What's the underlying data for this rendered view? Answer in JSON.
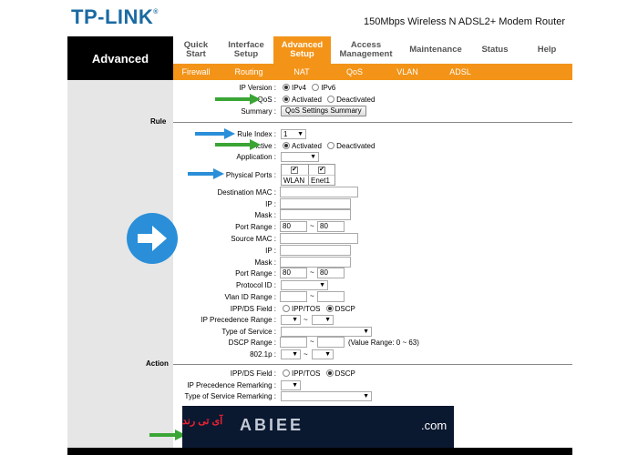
{
  "header": {
    "logo": "TP-LINK",
    "model": "150Mbps Wireless N ADSL2+ Modem Router"
  },
  "nav": {
    "left_title": "Advanced",
    "tabs": [
      {
        "l1": "Quick",
        "l2": "Start"
      },
      {
        "l1": "Interface",
        "l2": "Setup"
      },
      {
        "l1": "Advanced",
        "l2": "Setup"
      },
      {
        "l1": "Access",
        "l2": "Management"
      },
      {
        "l1": "Maintenance",
        "l2": ""
      },
      {
        "l1": "Status",
        "l2": ""
      },
      {
        "l1": "Help",
        "l2": ""
      }
    ],
    "subtabs": [
      "Firewall",
      "Routing",
      "NAT",
      "QoS",
      "VLAN",
      "ADSL"
    ]
  },
  "qos": {
    "ip_version_label": "IP Version :",
    "ipv4": "IPv4",
    "ipv6": "IPv6",
    "qos_label": "QoS :",
    "activated": "Activated",
    "deactivated": "Deactivated",
    "summary_label": "Summary :",
    "summary_button": "QoS Settings Summary"
  },
  "rule": {
    "section": "Rule",
    "rule_index_label": "Rule Index :",
    "rule_index_value": "1",
    "active_label": "Active :",
    "activated": "Activated",
    "deactivated": "Deactivated",
    "application_label": "Application :",
    "physical_ports_label": "Physical Ports :",
    "port_wlan": "WLAN",
    "port_enet1": "Enet1",
    "dest_mac_label": "Destination MAC :",
    "ip_label": "IP :",
    "mask_label": "Mask :",
    "port_range_label": "Port Range :",
    "port_from": "80",
    "port_to": "80",
    "tilde": "~",
    "source_mac_label": "Source MAC :",
    "protocol_id_label": "Protocol ID :",
    "vlan_range_label": "Vlan ID Range :",
    "ippds_label": "IPP/DS Field :",
    "ipptos": "IPP/TOS",
    "dscp": "DSCP",
    "ip_prec_range_label": "IP Precedence Range :",
    "tos_label": "Type of Service :",
    "dscp_range_label": "DSCP Range :",
    "dscp_range_hint": "(Value Range: 0 ~ 63)",
    "dot1p_label": "802.1p :"
  },
  "action": {
    "section": "Action",
    "ippds_label": "IPP/DS Field :",
    "ipptos": "IPP/TOS",
    "dscp": "DSCP",
    "ip_prec_remark_label": "IP Precedence Remarking :",
    "tos_remark_label": "Type of Service Remarking :"
  },
  "watermark": {
    "text": "ABIEE",
    "com": ".com",
    "fa": "آی تی رند"
  },
  "colors": {
    "orange": "#f39419",
    "logo_blue": "#1a6aa3",
    "arrow_blue": "#2a8fd8",
    "arrow_green": "#3aa535"
  }
}
